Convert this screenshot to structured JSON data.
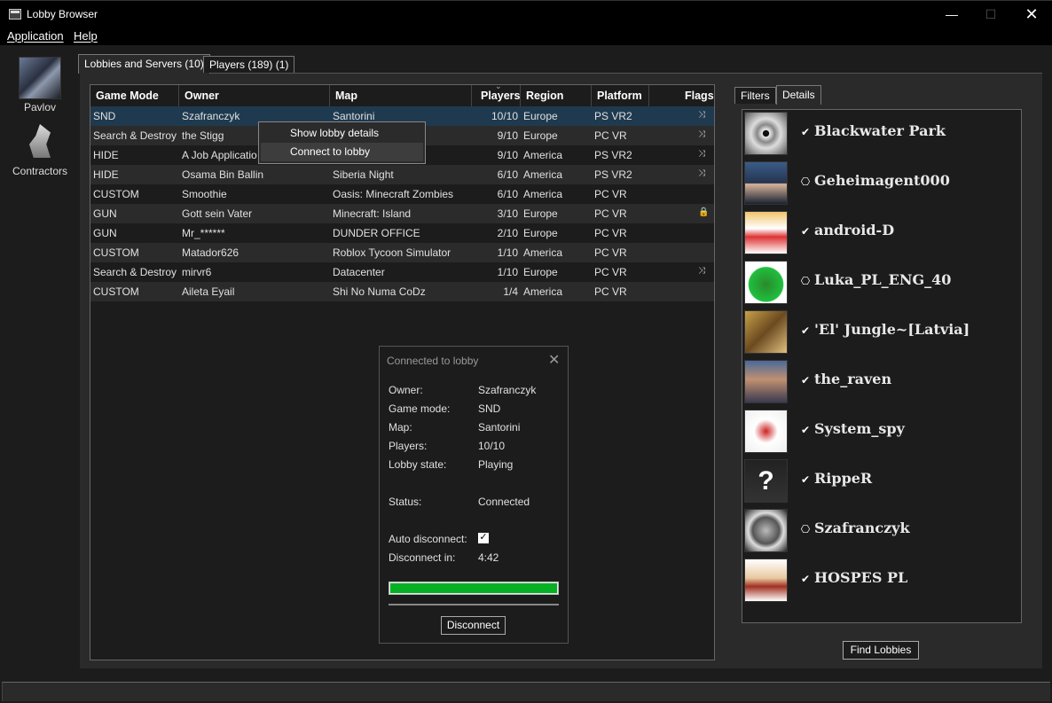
{
  "window": {
    "title": "Lobby Browser"
  },
  "menu": {
    "application": "Application",
    "help": "Help"
  },
  "sidebar": {
    "items": [
      {
        "label": "Pavlov"
      },
      {
        "label": "Contractors"
      }
    ]
  },
  "tabs": {
    "lobbies": "Lobbies and Servers (10)",
    "players": "Players (189) (1)"
  },
  "table": {
    "columns": [
      "Game Mode",
      "Owner",
      "Map",
      "Players",
      "Region",
      "Platform",
      "Flags"
    ],
    "rows": [
      {
        "mode": "SND",
        "owner": "Szafranczyk",
        "map": "Santorini",
        "players": "10/10",
        "region": "Europe",
        "platform": "PS VR2",
        "flag": "⤨"
      },
      {
        "mode": "Search & Destroy",
        "owner": "the Stigg",
        "map": "",
        "players": "9/10",
        "region": "Europe",
        "platform": "PC VR",
        "flag": "⤨"
      },
      {
        "mode": "HIDE",
        "owner": "A Job Applicatio",
        "map": "",
        "players": "9/10",
        "region": "America",
        "platform": "PS VR2",
        "flag": "⤨"
      },
      {
        "mode": "HIDE",
        "owner": "Osama Bin Ballin",
        "map": "Siberia Night",
        "players": "6/10",
        "region": "America",
        "platform": "PS VR2",
        "flag": "⤨"
      },
      {
        "mode": "CUSTOM",
        "owner": "Smoothie",
        "map": "Oasis: Minecraft Zombies",
        "players": "6/10",
        "region": "America",
        "platform": "PC VR",
        "flag": ""
      },
      {
        "mode": "GUN",
        "owner": "Gott sein Vater",
        "map": "Minecraft: Island",
        "players": "3/10",
        "region": "Europe",
        "platform": "PC VR",
        "flag": "🔒"
      },
      {
        "mode": "GUN",
        "owner": "Mr_******",
        "map": "DUNDER OFFICE",
        "players": "2/10",
        "region": "Europe",
        "platform": "PC VR",
        "flag": ""
      },
      {
        "mode": "CUSTOM",
        "owner": "Matador626",
        "map": "Roblox Tycoon Simulator",
        "players": "1/10",
        "region": "America",
        "platform": "PC VR",
        "flag": ""
      },
      {
        "mode": "Search & Destroy",
        "owner": "mirvr6",
        "map": "Datacenter",
        "players": "1/10",
        "region": "Europe",
        "platform": "PC VR",
        "flag": "⤨"
      },
      {
        "mode": "CUSTOM",
        "owner": "Aileta Eyail",
        "map": "Shi No Numa CoDz",
        "players": "1/4",
        "region": "America",
        "platform": "PC VR",
        "flag": ""
      }
    ]
  },
  "context_menu": {
    "show_details": "Show lobby details",
    "connect": "Connect to lobby"
  },
  "dialog": {
    "title": "Connected to lobby",
    "owner_label": "Owner:",
    "owner": "Szafranczyk",
    "mode_label": "Game mode:",
    "mode": "SND",
    "map_label": "Map:",
    "map": "Santorini",
    "players_label": "Players:",
    "players": "10/10",
    "state_label": "Lobby state:",
    "state": "Playing",
    "status_label": "Status:",
    "status": "Connected",
    "auto_label": "Auto disconnect:",
    "auto_checked": true,
    "countdown_label": "Disconnect in:",
    "countdown": "4:42",
    "progress": 1.0,
    "disconnect_button": "Disconnect"
  },
  "right_panel": {
    "tab_filters": "Filters",
    "tab_details": "Details",
    "players": [
      {
        "name": "Blackwater Park",
        "platform": "steam"
      },
      {
        "name": "Geheimagent000",
        "platform": "playstation"
      },
      {
        "name": "android-D",
        "platform": "steam"
      },
      {
        "name": "Luka_PL_ENG_40",
        "platform": "playstation"
      },
      {
        "name": "'El' Jungle~[Latvia]",
        "platform": "steam"
      },
      {
        "name": "the_raven",
        "platform": "steam"
      },
      {
        "name": "System_spy",
        "platform": "steam"
      },
      {
        "name": "RippeR",
        "platform": "steam"
      },
      {
        "name": "Szafranczyk",
        "platform": "playstation"
      },
      {
        "name": "HOSPES PL",
        "platform": "steam"
      }
    ],
    "find_button": "Find Lobbies"
  },
  "colors": {
    "accent_progress": "#06b025",
    "selected_row": "#1f3a4f"
  }
}
